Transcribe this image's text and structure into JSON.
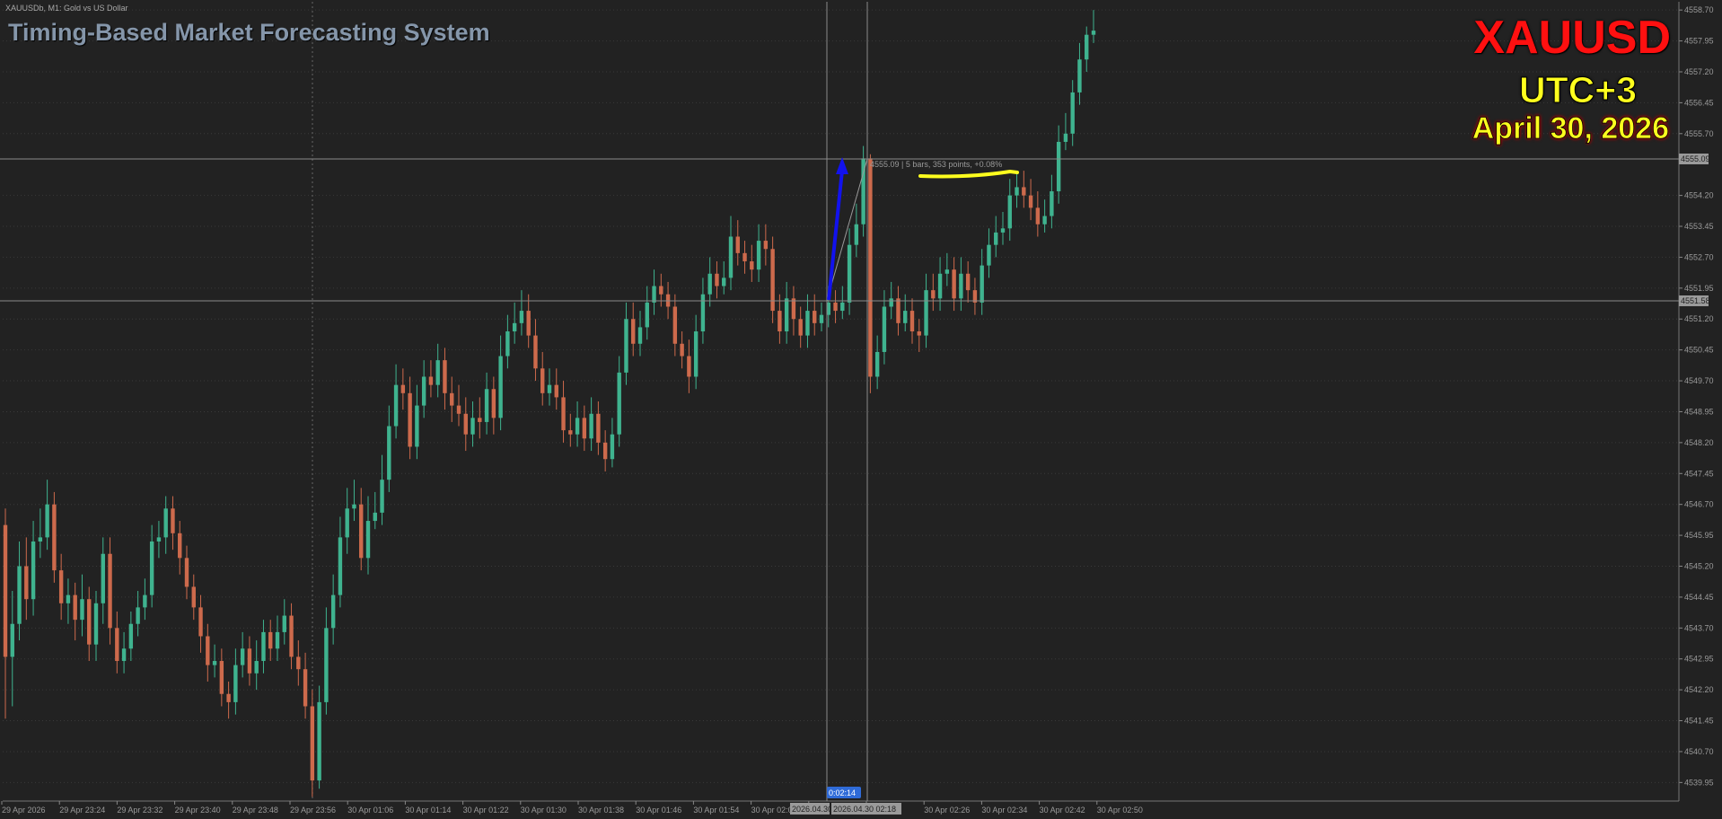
{
  "header": {
    "chart_info": "XAUUSDb, M1:  Gold vs US Dollar",
    "brand": "Timing-Based Market Forecasting System",
    "symbol": "XAUUSD",
    "timezone": "UTC+3",
    "date": "April 30, 2026"
  },
  "colors": {
    "background": "#222222",
    "bull": "#3fb38f",
    "bear": "#cd6a4c",
    "grid": "#3a3a3a",
    "crosshair": "#8a8a8a",
    "arrow": "#1212ee",
    "highlight": "#ffff1e"
  },
  "chart_data": {
    "type": "candlestick",
    "timeframe": "M1",
    "ylim": [
      4539.5,
      4558.9
    ],
    "y_ticks": [
      "4558.70",
      "4557.95",
      "4557.20",
      "4556.45",
      "4555.70",
      "4554.20",
      "4553.45",
      "4552.70",
      "4551.95",
      "4551.20",
      "4550.45",
      "4549.70",
      "4548.95",
      "4548.20",
      "4547.45",
      "4546.70",
      "4545.95",
      "4545.20",
      "4544.45",
      "4543.70",
      "4542.95",
      "4542.20",
      "4541.45",
      "4540.70",
      "4539.95"
    ],
    "x_ticks": [
      "29 Apr 2026",
      "29 Apr 23:24",
      "29 Apr 23:32",
      "29 Apr 23:40",
      "29 Apr 23:48",
      "29 Apr 23:56",
      "30 Apr 01:06",
      "30 Apr 01:14",
      "30 Apr 01:22",
      "30 Apr 01:30",
      "30 Apr 01:38",
      "30 Apr 01:46",
      "30 Apr 01:54",
      "30 Apr 02:02",
      "",
      "",
      "30 Apr 02:26",
      "30 Apr 02:34",
      "30 Apr 02:42",
      "30 Apr 02:50"
    ],
    "crosshair_x_labels": [
      "2026.04.30",
      "2026.04.30 02:18"
    ],
    "countdown_label": "0:02:14",
    "price_tags": [
      "4555.09",
      "4551.58"
    ],
    "measure_label": "4555.09 | 5 bars, 353 points, +0.08%",
    "candles": [
      {
        "o": 4546.2,
        "c": 4543.0,
        "h": 4546.6,
        "l": 4541.5
      },
      {
        "o": 4543.0,
        "c": 4543.8,
        "h": 4544.6,
        "l": 4541.8
      },
      {
        "o": 4543.8,
        "c": 4545.2,
        "h": 4545.8,
        "l": 4543.4
      },
      {
        "o": 4545.2,
        "c": 4544.4,
        "h": 4545.9,
        "l": 4543.9
      },
      {
        "o": 4544.4,
        "c": 4545.8,
        "h": 4546.3,
        "l": 4544.0
      },
      {
        "o": 4545.8,
        "c": 4545.9,
        "h": 4546.6,
        "l": 4545.4
      },
      {
        "o": 4545.9,
        "c": 4546.7,
        "h": 4547.3,
        "l": 4545.6
      },
      {
        "o": 4546.7,
        "c": 4545.1,
        "h": 4547.0,
        "l": 4544.8
      },
      {
        "o": 4545.1,
        "c": 4544.3,
        "h": 4545.5,
        "l": 4543.9
      },
      {
        "o": 4544.3,
        "c": 4544.5,
        "h": 4544.9,
        "l": 4543.8
      },
      {
        "o": 4544.5,
        "c": 4543.9,
        "h": 4544.8,
        "l": 4543.4
      },
      {
        "o": 4543.9,
        "c": 4544.4,
        "h": 4545.0,
        "l": 4543.5
      },
      {
        "o": 4544.4,
        "c": 4543.3,
        "h": 4544.7,
        "l": 4542.9
      },
      {
        "o": 4543.3,
        "c": 4544.3,
        "h": 4544.6,
        "l": 4542.9
      },
      {
        "o": 4544.3,
        "c": 4545.5,
        "h": 4545.9,
        "l": 4543.8
      },
      {
        "o": 4545.5,
        "c": 4543.7,
        "h": 4545.9,
        "l": 4543.3
      },
      {
        "o": 4543.7,
        "c": 4542.9,
        "h": 4544.1,
        "l": 4542.6
      },
      {
        "o": 4542.9,
        "c": 4543.2,
        "h": 4543.6,
        "l": 4542.6
      },
      {
        "o": 4543.2,
        "c": 4543.8,
        "h": 4544.1,
        "l": 4542.9
      },
      {
        "o": 4543.8,
        "c": 4544.2,
        "h": 4544.6,
        "l": 4543.5
      },
      {
        "o": 4544.2,
        "c": 4544.5,
        "h": 4544.9,
        "l": 4543.9
      },
      {
        "o": 4544.5,
        "c": 4545.8,
        "h": 4546.2,
        "l": 4544.2
      },
      {
        "o": 4545.8,
        "c": 4545.9,
        "h": 4546.3,
        "l": 4545.4
      },
      {
        "o": 4545.9,
        "c": 4546.6,
        "h": 4546.9,
        "l": 4545.5
      },
      {
        "o": 4546.6,
        "c": 4546.0,
        "h": 4546.9,
        "l": 4545.6
      },
      {
        "o": 4546.0,
        "c": 4545.4,
        "h": 4546.3,
        "l": 4545.0
      },
      {
        "o": 4545.4,
        "c": 4544.7,
        "h": 4545.7,
        "l": 4544.4
      },
      {
        "o": 4544.7,
        "c": 4544.2,
        "h": 4545.0,
        "l": 4543.9
      },
      {
        "o": 4544.2,
        "c": 4543.5,
        "h": 4544.5,
        "l": 4543.1
      },
      {
        "o": 4543.5,
        "c": 4542.8,
        "h": 4543.8,
        "l": 4542.4
      },
      {
        "o": 4542.8,
        "c": 4542.9,
        "h": 4543.3,
        "l": 4542.5
      },
      {
        "o": 4542.9,
        "c": 4542.1,
        "h": 4543.2,
        "l": 4541.8
      },
      {
        "o": 4542.1,
        "c": 4541.9,
        "h": 4542.4,
        "l": 4541.5
      },
      {
        "o": 4541.9,
        "c": 4542.8,
        "h": 4543.2,
        "l": 4541.6
      },
      {
        "o": 4542.8,
        "c": 4543.2,
        "h": 4543.6,
        "l": 4542.5
      },
      {
        "o": 4543.2,
        "c": 4542.6,
        "h": 4543.5,
        "l": 4542.3
      },
      {
        "o": 4542.6,
        "c": 4542.9,
        "h": 4543.4,
        "l": 4542.2
      },
      {
        "o": 4542.9,
        "c": 4543.6,
        "h": 4543.9,
        "l": 4542.6
      },
      {
        "o": 4543.6,
        "c": 4543.2,
        "h": 4543.9,
        "l": 4542.9
      },
      {
        "o": 4543.2,
        "c": 4543.6,
        "h": 4544.0,
        "l": 4542.9
      },
      {
        "o": 4543.6,
        "c": 4544.0,
        "h": 4544.4,
        "l": 4543.3
      },
      {
        "o": 4544.0,
        "c": 4543.0,
        "h": 4544.3,
        "l": 4542.7
      },
      {
        "o": 4543.0,
        "c": 4542.7,
        "h": 4543.4,
        "l": 4542.3
      },
      {
        "o": 4542.7,
        "c": 4541.8,
        "h": 4543.1,
        "l": 4541.5
      },
      {
        "o": 4541.8,
        "c": 4540.0,
        "h": 4542.2,
        "l": 4539.6
      },
      {
        "o": 4540.0,
        "c": 4541.9,
        "h": 4542.3,
        "l": 4539.8
      },
      {
        "o": 4541.9,
        "c": 4543.7,
        "h": 4544.2,
        "l": 4541.6
      },
      {
        "o": 4543.7,
        "c": 4544.5,
        "h": 4545.0,
        "l": 4543.3
      },
      {
        "o": 4544.5,
        "c": 4545.9,
        "h": 4546.4,
        "l": 4544.2
      },
      {
        "o": 4545.9,
        "c": 4546.6,
        "h": 4547.1,
        "l": 4545.5
      },
      {
        "o": 4546.6,
        "c": 4546.7,
        "h": 4547.3,
        "l": 4546.3
      },
      {
        "o": 4546.7,
        "c": 4545.4,
        "h": 4547.1,
        "l": 4545.1
      },
      {
        "o": 4545.4,
        "c": 4546.3,
        "h": 4546.9,
        "l": 4545.0
      },
      {
        "o": 4546.3,
        "c": 4546.5,
        "h": 4547.0,
        "l": 4546.1
      },
      {
        "o": 4546.5,
        "c": 4547.3,
        "h": 4547.9,
        "l": 4546.2
      },
      {
        "o": 4547.3,
        "c": 4548.6,
        "h": 4549.1,
        "l": 4547.0
      },
      {
        "o": 4548.6,
        "c": 4549.6,
        "h": 4550.1,
        "l": 4548.3
      },
      {
        "o": 4549.6,
        "c": 4549.4,
        "h": 4550.0,
        "l": 4549.0
      },
      {
        "o": 4549.4,
        "c": 4548.1,
        "h": 4549.8,
        "l": 4547.8
      },
      {
        "o": 4548.1,
        "c": 4549.1,
        "h": 4549.6,
        "l": 4547.8
      },
      {
        "o": 4549.1,
        "c": 4549.8,
        "h": 4550.2,
        "l": 4548.8
      },
      {
        "o": 4549.8,
        "c": 4549.6,
        "h": 4550.2,
        "l": 4549.3
      },
      {
        "o": 4549.6,
        "c": 4550.2,
        "h": 4550.6,
        "l": 4549.3
      },
      {
        "o": 4550.2,
        "c": 4549.4,
        "h": 4550.5,
        "l": 4549.0
      },
      {
        "o": 4549.4,
        "c": 4549.1,
        "h": 4549.8,
        "l": 4548.7
      },
      {
        "o": 4549.1,
        "c": 4548.9,
        "h": 4549.6,
        "l": 4548.6
      },
      {
        "o": 4548.9,
        "c": 4548.4,
        "h": 4549.3,
        "l": 4548.0
      },
      {
        "o": 4548.4,
        "c": 4548.8,
        "h": 4549.2,
        "l": 4548.1
      },
      {
        "o": 4548.8,
        "c": 4548.7,
        "h": 4549.3,
        "l": 4548.3
      },
      {
        "o": 4548.7,
        "c": 4549.5,
        "h": 4549.9,
        "l": 4548.4
      },
      {
        "o": 4549.5,
        "c": 4548.8,
        "h": 4549.8,
        "l": 4548.4
      },
      {
        "o": 4548.8,
        "c": 4550.3,
        "h": 4550.8,
        "l": 4548.5
      },
      {
        "o": 4550.3,
        "c": 4550.9,
        "h": 4551.3,
        "l": 4550.0
      },
      {
        "o": 4550.9,
        "c": 4551.1,
        "h": 4551.6,
        "l": 4550.6
      },
      {
        "o": 4551.1,
        "c": 4551.4,
        "h": 4551.9,
        "l": 4550.8
      },
      {
        "o": 4551.4,
        "c": 4550.8,
        "h": 4551.8,
        "l": 4550.5
      },
      {
        "o": 4550.8,
        "c": 4550.0,
        "h": 4551.2,
        "l": 4549.7
      },
      {
        "o": 4550.0,
        "c": 4549.4,
        "h": 4550.4,
        "l": 4549.1
      },
      {
        "o": 4549.4,
        "c": 4549.6,
        "h": 4550.0,
        "l": 4549.1
      },
      {
        "o": 4549.6,
        "c": 4549.3,
        "h": 4550.0,
        "l": 4549.0
      },
      {
        "o": 4549.3,
        "c": 4548.5,
        "h": 4549.7,
        "l": 4548.2
      },
      {
        "o": 4548.5,
        "c": 4548.4,
        "h": 4548.9,
        "l": 4548.1
      },
      {
        "o": 4548.4,
        "c": 4548.8,
        "h": 4549.2,
        "l": 4548.1
      },
      {
        "o": 4548.8,
        "c": 4548.3,
        "h": 4549.1,
        "l": 4548.0
      },
      {
        "o": 4548.3,
        "c": 4548.9,
        "h": 4549.3,
        "l": 4548.0
      },
      {
        "o": 4548.9,
        "c": 4548.2,
        "h": 4549.2,
        "l": 4547.9
      },
      {
        "o": 4548.2,
        "c": 4547.8,
        "h": 4548.5,
        "l": 4547.5
      },
      {
        "o": 4547.8,
        "c": 4548.4,
        "h": 4548.8,
        "l": 4547.6
      },
      {
        "o": 4548.4,
        "c": 4549.9,
        "h": 4550.3,
        "l": 4548.1
      },
      {
        "o": 4549.9,
        "c": 4551.2,
        "h": 4551.6,
        "l": 4549.6
      },
      {
        "o": 4551.2,
        "c": 4550.6,
        "h": 4551.6,
        "l": 4550.3
      },
      {
        "o": 4550.6,
        "c": 4551.0,
        "h": 4551.4,
        "l": 4550.3
      },
      {
        "o": 4551.0,
        "c": 4551.6,
        "h": 4552.0,
        "l": 4550.7
      },
      {
        "o": 4551.6,
        "c": 4552.0,
        "h": 4552.4,
        "l": 4551.3
      },
      {
        "o": 4552.0,
        "c": 4551.8,
        "h": 4552.3,
        "l": 4551.5
      },
      {
        "o": 4551.8,
        "c": 4551.5,
        "h": 4552.1,
        "l": 4551.2
      },
      {
        "o": 4551.5,
        "c": 4550.6,
        "h": 4551.8,
        "l": 4550.3
      },
      {
        "o": 4550.6,
        "c": 4550.3,
        "h": 4550.9,
        "l": 4550.0
      },
      {
        "o": 4550.3,
        "c": 4549.8,
        "h": 4550.7,
        "l": 4549.4
      },
      {
        "o": 4549.8,
        "c": 4550.9,
        "h": 4551.3,
        "l": 4549.5
      },
      {
        "o": 4550.9,
        "c": 4551.8,
        "h": 4552.2,
        "l": 4550.6
      },
      {
        "o": 4551.8,
        "c": 4552.3,
        "h": 4552.7,
        "l": 4551.5
      },
      {
        "o": 4552.3,
        "c": 4552.0,
        "h": 4552.6,
        "l": 4551.7
      },
      {
        "o": 4552.0,
        "c": 4552.2,
        "h": 4552.6,
        "l": 4551.8
      },
      {
        "o": 4552.2,
        "c": 4553.2,
        "h": 4553.7,
        "l": 4551.9
      },
      {
        "o": 4553.2,
        "c": 4552.8,
        "h": 4553.6,
        "l": 4552.5
      },
      {
        "o": 4552.8,
        "c": 4552.6,
        "h": 4553.1,
        "l": 4552.3
      },
      {
        "o": 4552.6,
        "c": 4552.4,
        "h": 4553.0,
        "l": 4552.1
      },
      {
        "o": 4552.4,
        "c": 4553.1,
        "h": 4553.5,
        "l": 4552.1
      },
      {
        "o": 4553.1,
        "c": 4552.9,
        "h": 4553.5,
        "l": 4552.5
      },
      {
        "o": 4552.9,
        "c": 4551.4,
        "h": 4553.2,
        "l": 4551.1
      },
      {
        "o": 4551.4,
        "c": 4550.9,
        "h": 4551.8,
        "l": 4550.6
      },
      {
        "o": 4550.9,
        "c": 4551.7,
        "h": 4552.1,
        "l": 4550.6
      },
      {
        "o": 4551.7,
        "c": 4551.2,
        "h": 4552.0,
        "l": 4550.8
      },
      {
        "o": 4551.2,
        "c": 4550.8,
        "h": 4551.5,
        "l": 4550.5
      },
      {
        "o": 4550.8,
        "c": 4551.4,
        "h": 4551.8,
        "l": 4550.5
      },
      {
        "o": 4551.4,
        "c": 4551.1,
        "h": 4551.8,
        "l": 4550.8
      },
      {
        "o": 4551.1,
        "c": 4551.3,
        "h": 4551.6,
        "l": 4550.9
      },
      {
        "o": 4551.3,
        "c": 4551.6,
        "h": 4552.0,
        "l": 4551.0
      },
      {
        "o": 4551.6,
        "c": 4551.4,
        "h": 4551.9,
        "l": 4551.1
      },
      {
        "o": 4551.4,
        "c": 4551.6,
        "h": 4552.0,
        "l": 4551.2
      },
      {
        "o": 4551.6,
        "c": 4553.0,
        "h": 4553.4,
        "l": 4551.3
      },
      {
        "o": 4553.0,
        "c": 4553.5,
        "h": 4554.0,
        "l": 4552.7
      },
      {
        "o": 4553.5,
        "c": 4555.1,
        "h": 4555.4,
        "l": 4553.2
      },
      {
        "o": 4555.1,
        "c": 4549.8,
        "h": 4555.2,
        "l": 4549.4
      },
      {
        "o": 4549.8,
        "c": 4550.4,
        "h": 4550.8,
        "l": 4549.5
      },
      {
        "o": 4550.4,
        "c": 4551.5,
        "h": 4551.9,
        "l": 4550.1
      },
      {
        "o": 4551.5,
        "c": 4551.7,
        "h": 4552.1,
        "l": 4551.2
      },
      {
        "o": 4551.7,
        "c": 4551.1,
        "h": 4552.0,
        "l": 4550.8
      },
      {
        "o": 4551.1,
        "c": 4551.4,
        "h": 4551.8,
        "l": 4550.9
      },
      {
        "o": 4551.4,
        "c": 4550.9,
        "h": 4551.7,
        "l": 4550.6
      },
      {
        "o": 4550.9,
        "c": 4550.8,
        "h": 4551.2,
        "l": 4550.4
      },
      {
        "o": 4550.8,
        "c": 4551.9,
        "h": 4552.3,
        "l": 4550.5
      },
      {
        "o": 4551.9,
        "c": 4551.7,
        "h": 4552.3,
        "l": 4551.4
      },
      {
        "o": 4551.7,
        "c": 4552.3,
        "h": 4552.7,
        "l": 4551.4
      },
      {
        "o": 4552.3,
        "c": 4552.4,
        "h": 4552.8,
        "l": 4552.0
      },
      {
        "o": 4552.4,
        "c": 4551.7,
        "h": 4552.7,
        "l": 4551.4
      },
      {
        "o": 4551.7,
        "c": 4552.3,
        "h": 4552.7,
        "l": 4551.4
      },
      {
        "o": 4552.3,
        "c": 4551.9,
        "h": 4552.6,
        "l": 4551.6
      },
      {
        "o": 4551.9,
        "c": 4551.6,
        "h": 4552.2,
        "l": 4551.3
      },
      {
        "o": 4551.6,
        "c": 4552.5,
        "h": 4552.9,
        "l": 4551.3
      },
      {
        "o": 4552.5,
        "c": 4553.0,
        "h": 4553.4,
        "l": 4552.2
      },
      {
        "o": 4553.0,
        "c": 4553.3,
        "h": 4553.7,
        "l": 4552.7
      },
      {
        "o": 4553.3,
        "c": 4553.4,
        "h": 4553.8,
        "l": 4553.0
      },
      {
        "o": 4553.4,
        "c": 4554.2,
        "h": 4554.6,
        "l": 4553.1
      },
      {
        "o": 4554.2,
        "c": 4554.4,
        "h": 4554.8,
        "l": 4553.9
      },
      {
        "o": 4554.4,
        "c": 4554.2,
        "h": 4554.8,
        "l": 4553.9
      },
      {
        "o": 4554.2,
        "c": 4553.9,
        "h": 4554.6,
        "l": 4553.6
      },
      {
        "o": 4553.9,
        "c": 4553.5,
        "h": 4554.3,
        "l": 4553.2
      },
      {
        "o": 4553.5,
        "c": 4553.7,
        "h": 4554.1,
        "l": 4553.3
      },
      {
        "o": 4553.7,
        "c": 4554.3,
        "h": 4554.7,
        "l": 4553.4
      },
      {
        "o": 4554.3,
        "c": 4555.5,
        "h": 4555.9,
        "l": 4554.0
      },
      {
        "o": 4555.5,
        "c": 4555.7,
        "h": 4556.2,
        "l": 4555.3
      },
      {
        "o": 4555.7,
        "c": 4556.7,
        "h": 4557.0,
        "l": 4555.4
      },
      {
        "o": 4556.7,
        "c": 4557.5,
        "h": 4557.9,
        "l": 4556.4
      },
      {
        "o": 4557.5,
        "c": 4558.1,
        "h": 4558.3,
        "l": 4557.2
      },
      {
        "o": 4558.1,
        "c": 4558.2,
        "h": 4558.7,
        "l": 4557.9
      }
    ]
  }
}
